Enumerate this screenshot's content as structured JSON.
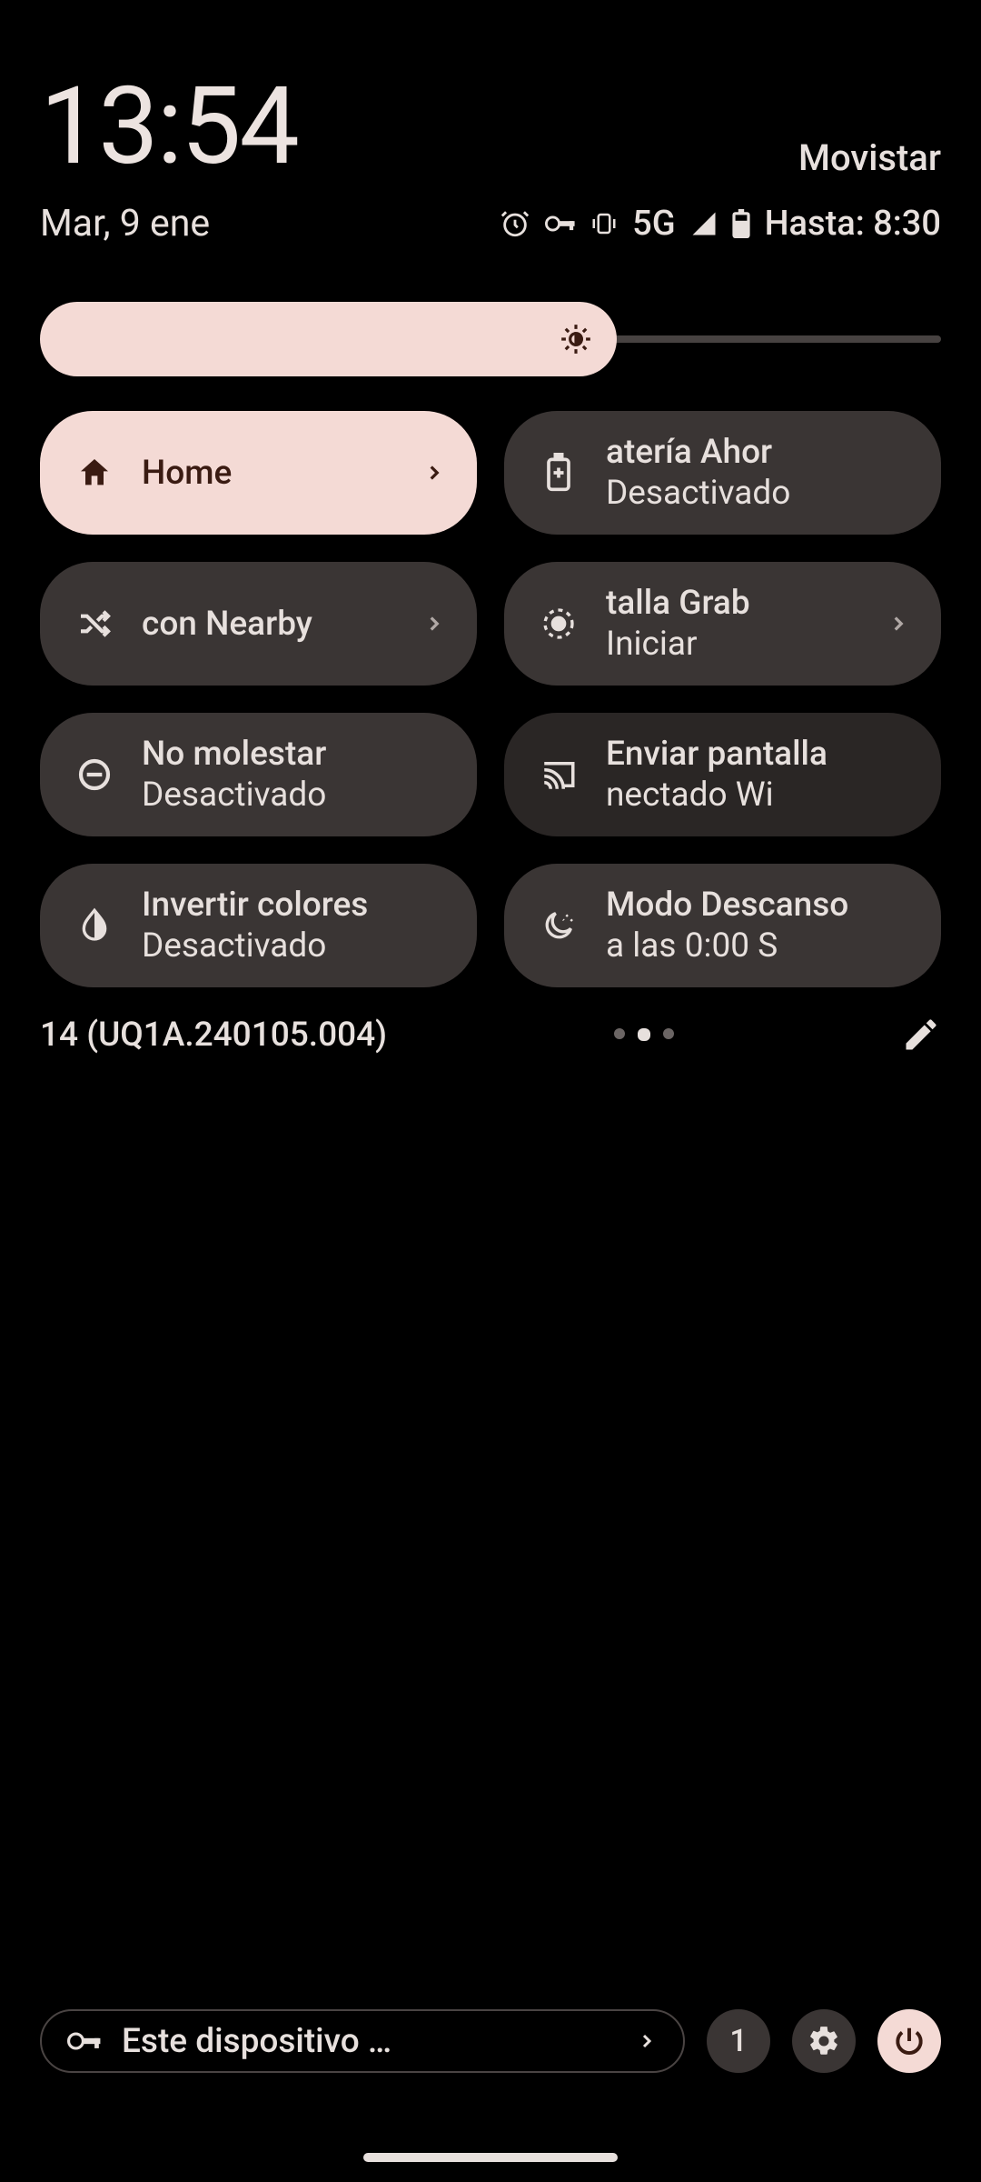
{
  "clock": "13:54",
  "date": "Mar, 9 ene",
  "carrier": "Movistar",
  "status": {
    "network": "5G",
    "battery_text": "Hasta: 8:30"
  },
  "brightness": {
    "percent": 64
  },
  "tiles": [
    {
      "id": "home",
      "title": "Home",
      "sub": "",
      "active": true,
      "chevron": true,
      "icon": "home"
    },
    {
      "id": "battery-saver",
      "title": "atería        Ahor",
      "sub": "Desactivado",
      "icon": "battery-plus"
    },
    {
      "id": "nearby",
      "title": "con Nearby",
      "sub": "",
      "chevron": true,
      "icon": "shuffle"
    },
    {
      "id": "screen-record",
      "title": "talla        Grab",
      "sub": "Iniciar",
      "chevron": true,
      "icon": "record"
    },
    {
      "id": "dnd",
      "title": "No molestar",
      "sub": "Desactivado",
      "icon": "dnd"
    },
    {
      "id": "cast",
      "title": "Enviar pantalla",
      "sub": "nectado        Wi",
      "dim": true,
      "icon": "cast"
    },
    {
      "id": "invert",
      "title": "Invertir colores",
      "sub": "Desactivado",
      "icon": "invert"
    },
    {
      "id": "bedtime",
      "title": "Modo Descanso",
      "sub": "a las 0:00         S",
      "icon": "moon"
    }
  ],
  "build": "14 (UQ1A.240105.004)",
  "page_index": 1,
  "page_count": 3,
  "bottom": {
    "device_label": "Este dispositivo …",
    "user_count": "1"
  }
}
